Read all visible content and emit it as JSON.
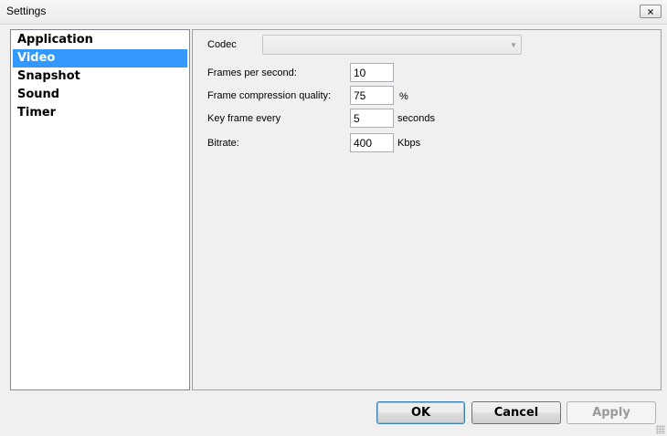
{
  "window": {
    "title": "Settings",
    "close_glyph": "×"
  },
  "categories": [
    {
      "label": "Application",
      "selected": false
    },
    {
      "label": "Video",
      "selected": true
    },
    {
      "label": "Snapshot",
      "selected": false
    },
    {
      "label": "Sound",
      "selected": false
    },
    {
      "label": "Timer",
      "selected": false
    }
  ],
  "video": {
    "codec": {
      "label": "Codec",
      "value": "",
      "arrow_glyph": "▼"
    },
    "fps": {
      "label": "Frames per second:",
      "value": "10"
    },
    "quality": {
      "label": "Frame compression quality:",
      "value": "75",
      "unit": "%"
    },
    "keyframe": {
      "label": "Key frame every",
      "value": "5",
      "unit": "seconds"
    },
    "bitrate": {
      "label": "Bitrate:",
      "value": "400",
      "unit": "Kbps"
    }
  },
  "buttons": {
    "ok": "OK",
    "cancel": "Cancel",
    "apply": "Apply"
  },
  "colors": {
    "selection": "#3399ff",
    "default_button_border": "#3c7fb1"
  }
}
